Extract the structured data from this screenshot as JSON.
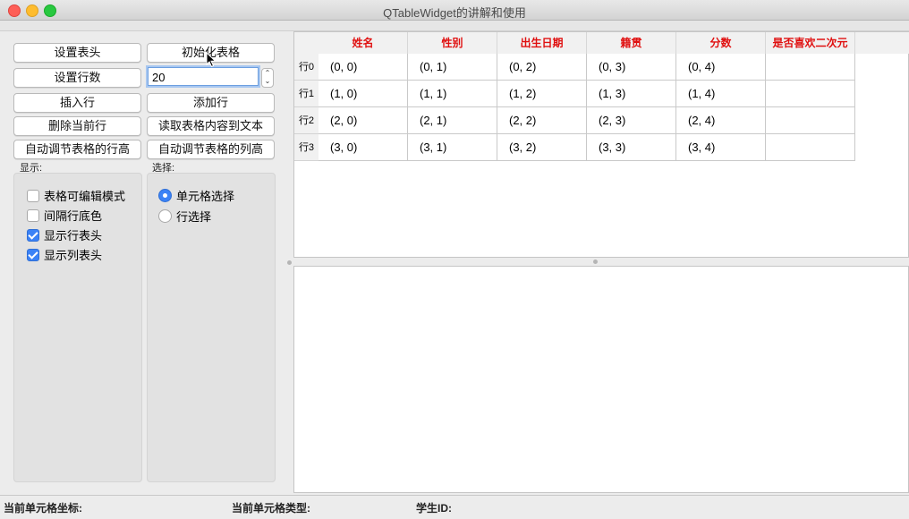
{
  "window": {
    "title": "QTableWidget的讲解和使用"
  },
  "buttons": {
    "set_header": "设置表头",
    "init_table": "初始化表格",
    "set_rows": "设置行数",
    "insert_row": "插入行",
    "add_row": "添加行",
    "delete_row": "删除当前行",
    "read_table": "读取表格内容到文本",
    "auto_row_height": "自动调节表格的行高",
    "auto_col_width": "自动调节表格的列高"
  },
  "row_count_input": {
    "value": "20"
  },
  "display_group": {
    "label": "显示:",
    "options": [
      {
        "label": "表格可编辑模式",
        "checked": false
      },
      {
        "label": "间隔行底色",
        "checked": false
      },
      {
        "label": "显示行表头",
        "checked": true
      },
      {
        "label": "显示列表头",
        "checked": true
      }
    ]
  },
  "select_group": {
    "label": "选择:",
    "options": [
      {
        "label": "单元格选择",
        "selected": true
      },
      {
        "label": "行选择",
        "selected": false
      }
    ]
  },
  "table": {
    "columns": [
      "姓名",
      "性别",
      "出生日期",
      "籍贯",
      "分数",
      "是否喜欢二次元"
    ],
    "rows": [
      {
        "header": "行0",
        "cells": [
          "(0, 0)",
          "(0, 1)",
          "(0, 2)",
          "(0, 3)",
          "(0, 4)",
          ""
        ]
      },
      {
        "header": "行1",
        "cells": [
          "(1, 0)",
          "(1, 1)",
          "(1, 2)",
          "(1, 3)",
          "(1, 4)",
          ""
        ]
      },
      {
        "header": "行2",
        "cells": [
          "(2, 0)",
          "(2, 1)",
          "(2, 2)",
          "(2, 3)",
          "(2, 4)",
          ""
        ]
      },
      {
        "header": "行3",
        "cells": [
          "(3, 0)",
          "(3, 1)",
          "(3, 2)",
          "(3, 3)",
          "(3, 4)",
          ""
        ]
      }
    ]
  },
  "statusbar": {
    "coord_label": "当前单元格坐标:",
    "type_label": "当前单元格类型:",
    "student_id_label": "学生ID:"
  },
  "colors": {
    "header_text": "#e01010",
    "accent": "#3b82f6"
  }
}
